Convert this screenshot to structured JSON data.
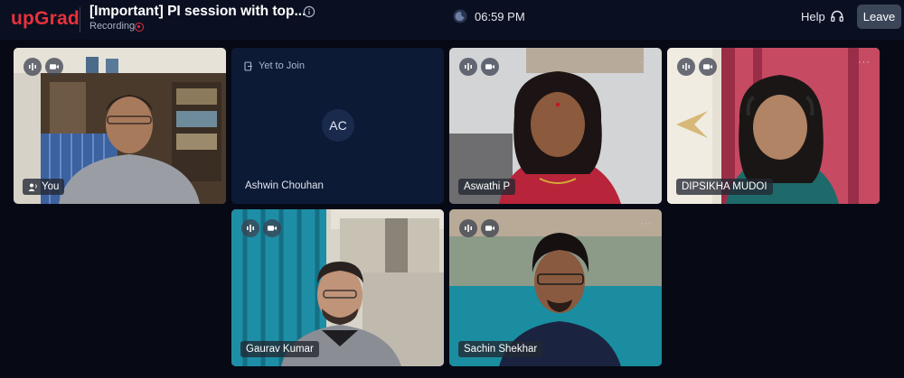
{
  "header": {
    "logo": "upGrad",
    "title": "[Important] PI session with top...",
    "recording_label": "Recording",
    "time": "06:59 PM",
    "help_label": "Help",
    "leave_label": "Leave"
  },
  "participants": [
    {
      "name": "You",
      "state": "video"
    },
    {
      "name": "Ashwin Chouhan",
      "state": "Yet to Join",
      "initials": "AC"
    },
    {
      "name": "Aswathi P",
      "state": "video"
    },
    {
      "name": "DIPSIKHA MUDOI",
      "state": "video"
    },
    {
      "name": "Gaurav Kumar",
      "state": "video"
    },
    {
      "name": "Sachin Shekhar",
      "state": "video"
    }
  ],
  "more_label": "···",
  "colors": {
    "brand": "#e8313c",
    "background": "#070a14",
    "topbar": "#0a1021",
    "pending_card": "#0d1a36"
  }
}
